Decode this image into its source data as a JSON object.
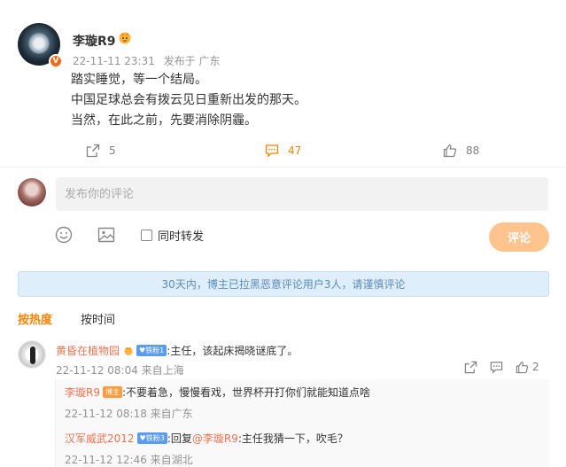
{
  "post": {
    "author": "李璇R9",
    "verified_badge": "V",
    "time": "22-11-11 23:31",
    "location": "发布于 广东",
    "lines": [
      "踏实睡觉，等一个结局。",
      "中国足球总会有拨云见日重新出发的那天。",
      "当然，在此之前，先要消除阴霾。"
    ],
    "repost_count": "5",
    "comment_count": "47",
    "like_count": "88",
    "icons": [
      "crown-icon",
      "share-icon",
      "comment-icon",
      "like-icon"
    ],
    "accent_color": "#ff8200"
  },
  "composer": {
    "placeholder": "发布你的评论",
    "repost_label": "同时转发",
    "submit_label": "评论",
    "icons": [
      "emoji-icon",
      "image-icon"
    ]
  },
  "notice": "30天内，博主已拉黑恶意评论用户3人，请谨慎评论",
  "sort": {
    "hot": "按热度",
    "time": "按时间"
  },
  "comment": {
    "user": "黄昏在植物园",
    "fan_badge": "铁粉1",
    "text": ":主任，该起床揭晓谜底了。",
    "time": "22-11-12 08:04 来自上海",
    "like_count": "2"
  },
  "replies": [
    {
      "user": "李璇R9",
      "badge": "博主",
      "text": ":不要着急，慢慢看戏，世界杯开打你们就能知道点啥",
      "time": "22-11-12 08:18 来自广东"
    },
    {
      "user": "汉军威武2012",
      "badge": "铁粉3",
      "prefix": ":回复",
      "mention": "@李璇R9",
      "text": ":主任我猜一下，吹毛？",
      "time": "22-11-12 12:46 来自湖北"
    }
  ]
}
